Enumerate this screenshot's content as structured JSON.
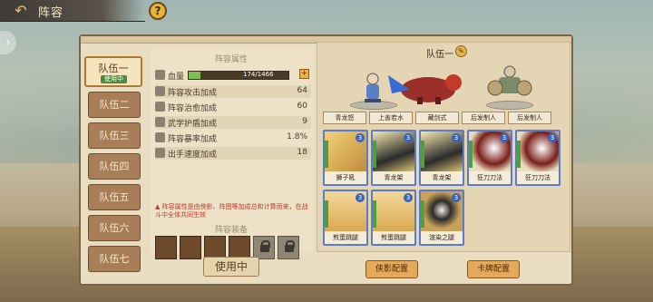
{
  "window": {
    "title": "阵容",
    "help": "?"
  },
  "tabs": [
    {
      "label": "队伍一",
      "badge": "使用中",
      "active": true
    },
    {
      "label": "队伍二"
    },
    {
      "label": "队伍三"
    },
    {
      "label": "队伍四"
    },
    {
      "label": "队伍五"
    },
    {
      "label": "队伍六"
    },
    {
      "label": "队伍七"
    }
  ],
  "attributes": {
    "section_title": "阵容属性",
    "hp_label": "血量",
    "hp_value": "174/1466",
    "hp_ratio": 0.119,
    "rows": [
      {
        "label": "阵容攻击加成",
        "value": "64"
      },
      {
        "label": "阵容治愈加成",
        "value": "60"
      },
      {
        "label": "武学护盾加成",
        "value": "9"
      },
      {
        "label": "阵容暴率加成",
        "value": "1.8%"
      },
      {
        "label": "出手速度加成",
        "value": "18"
      }
    ],
    "warning": "阵容属性是由侠影、阵图等加成总和计算而来，在战斗中全体共同生效",
    "equip_title": "阵容装备",
    "use_button": "使用中"
  },
  "formation": {
    "team_label": "队伍一",
    "top_row_cards": [
      "青龙怒",
      "上善若水",
      "藏剑式",
      "后发制人",
      "后发制人"
    ],
    "cards": [
      {
        "name": "狮子吼",
        "level": "3"
      },
      {
        "name": "青龙架",
        "level": "3"
      },
      {
        "name": "青龙架",
        "level": "3"
      },
      {
        "name": "狂刀刀法",
        "level": "3"
      },
      {
        "name": "狂刀刀法",
        "level": "3"
      },
      {
        "name": "煎蛋跳腿",
        "level": "3"
      },
      {
        "name": "煎蛋跳腿",
        "level": "3"
      },
      {
        "name": "渲染之腿",
        "level": "3"
      }
    ],
    "btn_shadow": "侠影配置",
    "btn_card": "卡牌配置"
  },
  "colors": {
    "accent": "#e6a95a",
    "panel": "#e9dcc0",
    "card_border": "#5c7cc8",
    "hp_fill": "#7cc253"
  }
}
